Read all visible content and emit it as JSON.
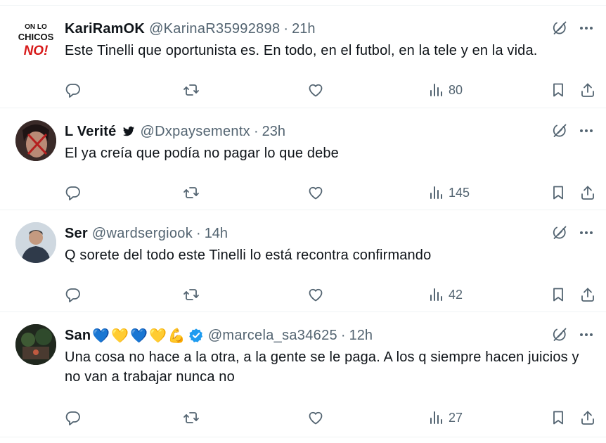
{
  "tweets": [
    {
      "name": "KariRamOK",
      "handle": "@KarinaR35992898",
      "time": "21h",
      "text": "Este Tinelli que oportunista es. En todo, en el futbol, en la tele y en la vida.",
      "views": "80",
      "avatar_lines": [
        "ON LO",
        "CHICOS",
        "NO!"
      ]
    },
    {
      "name": "L Verité",
      "handle": "@Dxpaysementx",
      "time": "23h",
      "text": "El ya creía que podía no pagar lo que debe",
      "views": "145"
    },
    {
      "name": "Ser",
      "handle": "@wardsergiook",
      "time": "14h",
      "text": "Q sorete del todo este Tinelli lo está recontra confirmando",
      "views": "42"
    },
    {
      "name": "San",
      "handle": "@marcela_sa34625",
      "time": "12h",
      "text": "Una cosa no hace a la otra, a la gente se le paga. A los q siempre hacen juicios y no van a trabajar nunca no",
      "views": "27",
      "emojis": [
        "💙",
        "💛",
        "💙",
        "💛",
        "💪"
      ]
    }
  ],
  "icons": [
    "grok-icon",
    "more-icon",
    "reply-icon",
    "retweet-icon",
    "like-icon",
    "views-icon",
    "bookmark-icon",
    "share-icon",
    "verified-badge-icon",
    "bird-icon"
  ],
  "colors": {
    "text": "#0f1419",
    "secondary": "#536471",
    "verified": "#1d9bf0",
    "divider": "#eff3f4"
  }
}
